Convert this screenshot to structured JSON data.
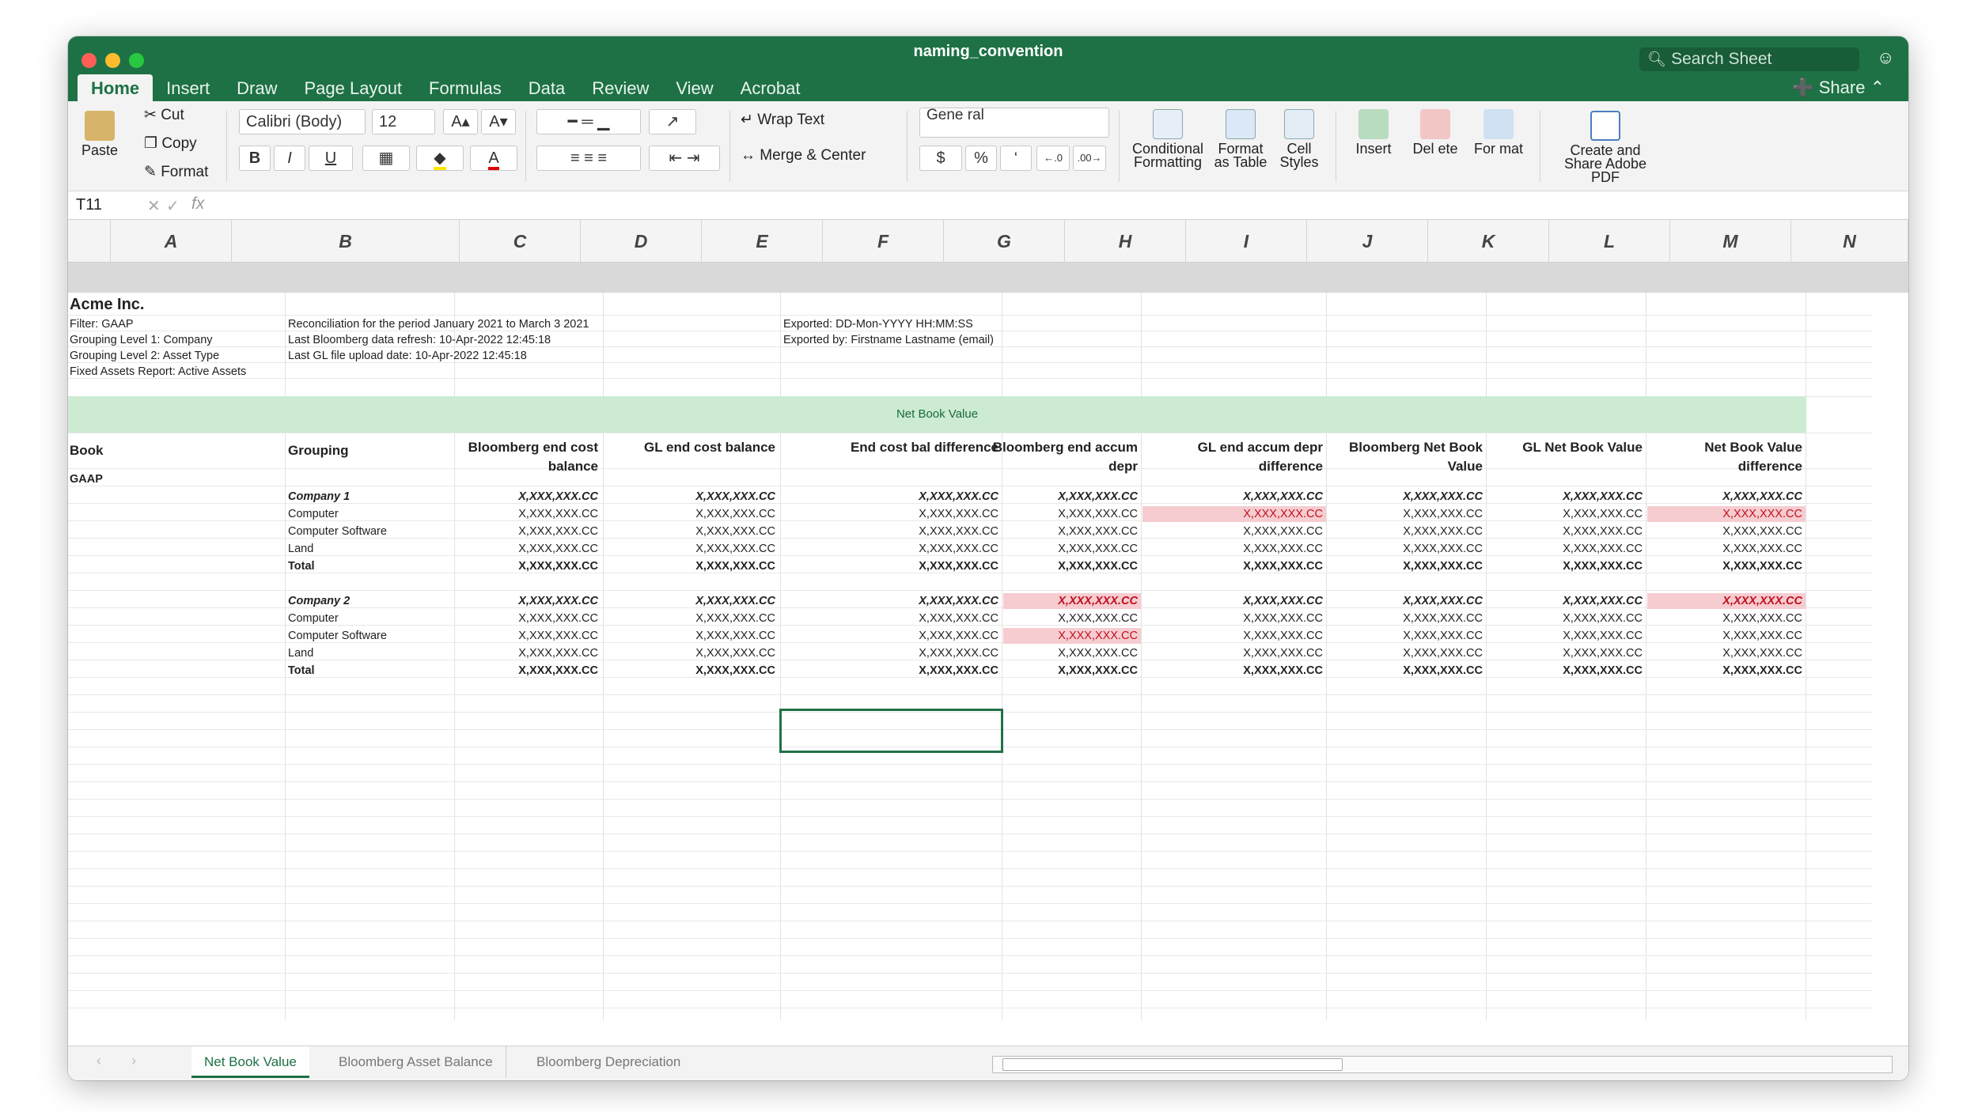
{
  "window": {
    "title": "naming_convention",
    "search_placeholder": "Search Sheet",
    "share_label": "Share"
  },
  "ribbon_tabs": [
    "Home",
    "Insert",
    "Draw",
    "Page Layout",
    "Formulas",
    "Data",
    "Review",
    "View",
    "Acrobat"
  ],
  "ribbon": {
    "paste": "Paste",
    "cut": "Cut",
    "copy": "Copy",
    "format": "Format",
    "font_name": "Calibri (Body)",
    "font_size": "12",
    "bold": "B",
    "italic": "I",
    "underline": "U",
    "wrap_text": "Wrap Text",
    "merge_center": "Merge & Center",
    "number_format": "Gene ral",
    "currency": "$",
    "percent": "%",
    "comma": "‘",
    "conditional_formatting": "Conditional Formatting",
    "format_as_table": "Format as Table",
    "cell_styles": "Cell Styles",
    "insert": "Insert",
    "delete": "Del ete",
    "format_cells": "For mat",
    "adobe": "Create and Share Adobe PDF"
  },
  "formula_bar": {
    "name_box": "T11",
    "fx": "fx"
  },
  "columns": [
    "A",
    "B",
    "C",
    "D",
    "E",
    "F",
    "G",
    "H",
    "I",
    "J",
    "K",
    "L",
    "M",
    "N"
  ],
  "sheet": {
    "company": "Acme Inc.",
    "meta_left": [
      "Filter: GAAP",
      "Grouping Level 1: Company",
      "Grouping Level 2: Asset Type",
      "Fixed Assets Report: Active Assets"
    ],
    "meta_mid": [
      "Reconciliation for the period January 2021 to March 3 2021",
      "Last Bloomberg data refresh: 10-Apr-2022 12:45:18",
      "Last GL file upload date: 10-Apr-2022 12:45:18"
    ],
    "meta_right": [
      "Exported: DD-Mon-YYYY HH:MM:SS",
      "Exported by: Firstname Lastname (email)"
    ],
    "band_title": "Net Book Value",
    "headers": [
      "Book",
      "Grouping",
      "Bloomberg end cost balance",
      "GL end cost balance",
      "End cost bal difference",
      "Bloomberg end accum depr",
      "GL end accum depr difference",
      "Bloomberg Net Book Value",
      "GL Net Book Value",
      "Net Book Value difference"
    ],
    "book": "GAAP",
    "value": "X,XXX,XXX.CC",
    "groups": [
      {
        "company": "Company 1",
        "rows": [
          "Computer",
          "Computer Software",
          "Land"
        ],
        "total": "Total"
      },
      {
        "company": "Company 2",
        "rows": [
          "Computer",
          "Computer Software",
          "Land"
        ],
        "total": "Total"
      }
    ]
  },
  "sheet_tabs": [
    "Net Book Value",
    "Bloomberg Asset Balance",
    "Bloomberg Depreciation"
  ],
  "colors": {
    "excel_green": "#1e7145",
    "band": "#cdebd3",
    "highlight": "#f6ccd0",
    "highlight_text": "#c0101e"
  }
}
